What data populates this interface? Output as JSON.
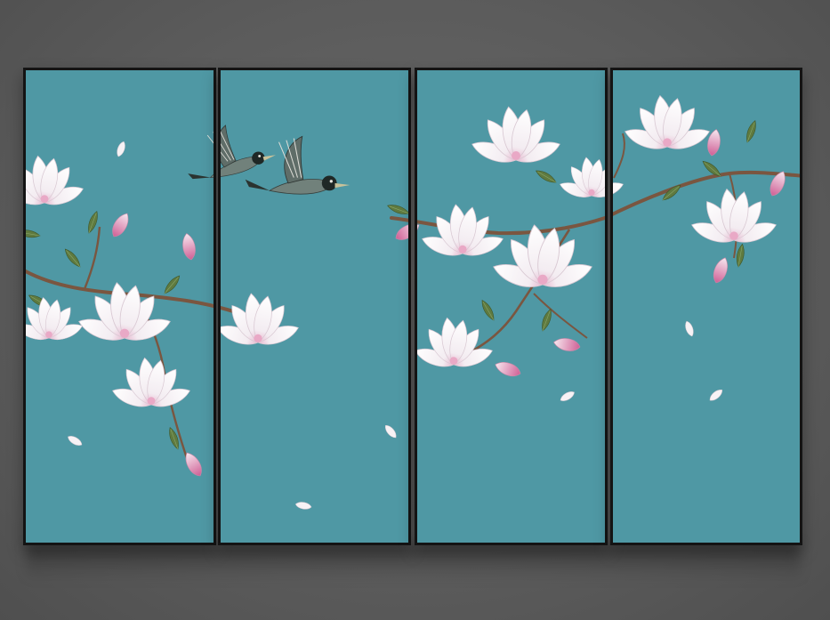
{
  "artwork": {
    "panel_count": 4,
    "colors": {
      "background": "#5e5e5e",
      "panel_fill": "#4f98a4",
      "frame": "#141414",
      "petal": "#f6f1f4",
      "petal_pink": "#d978a6",
      "leaf": "#5f7a3f",
      "branch": "#7a5640",
      "bird_body": "#6f7f7a",
      "bird_head": "#1d2524"
    },
    "icons": [
      "magnolia-blossom",
      "magnolia-bud",
      "leaf",
      "branch",
      "bird",
      "falling-petal"
    ]
  }
}
